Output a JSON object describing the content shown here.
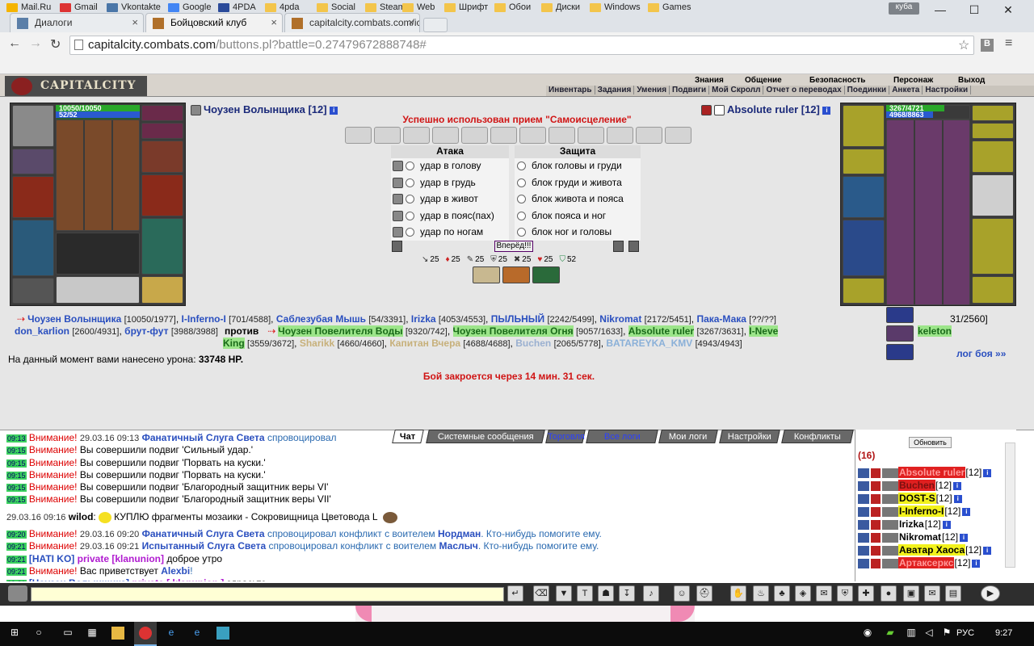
{
  "browser": {
    "tabs": [
      {
        "label": "Диалоги"
      },
      {
        "label": "Бойцовский клуб"
      },
      {
        "label": "capitalcity.combats.com/ic"
      }
    ],
    "profile": "куба",
    "url_host": "capitalcity.combats.com",
    "url_path": "/buttons.pl?battle=0.27479672888748#",
    "bookmarks": [
      "Mail.Ru",
      "Gmail",
      "Vkontakte",
      "Google",
      "4PDA",
      "4pda",
      "Social",
      "Steam",
      "Web",
      "Шрифт",
      "Обои",
      "Диски",
      "Windows",
      "Games"
    ]
  },
  "game": {
    "logo": "CAPITALCITY",
    "top_menu": [
      "Знания",
      "Общение",
      "Безопасность",
      "Персонаж",
      "Выход"
    ],
    "sub_menu": [
      "Инвентарь",
      "Задания",
      "Умения",
      "Подвиги",
      "Мой Скролл",
      "Отчет о переводах",
      "Поединки",
      "Анкета",
      "Настройки"
    ]
  },
  "left_player": {
    "name": "Чоузен Волынщика [12]",
    "hp": "10050/10050",
    "mana": "52/52"
  },
  "right_player": {
    "name": "Absolute ruler [12]",
    "hp": "3267/4721",
    "mana": "4968/8863"
  },
  "battle": {
    "message": "Успешно использован прием \"Самоисцеление\"",
    "attack_title": "Атака",
    "defense_title": "Защита",
    "attacks": [
      "удар в голову",
      "удар в грудь",
      "удар в живот",
      "удар в пояс(пах)",
      "удар по ногам"
    ],
    "defenses": [
      "блок головы и груди",
      "блок груди и живота",
      "блок живота и пояса",
      "блок пояса и ног",
      "блок ног и головы"
    ],
    "forward_button": "Вперёд!!!",
    "stats": [
      "25",
      "25",
      "25",
      "25",
      "25",
      "25",
      "52"
    ],
    "team1": [
      {
        "name": "Чоузен Волынщика",
        "hp": "[10050/1977]"
      },
      {
        "name": "I-Inferno-I",
        "hp": "[701/4588]"
      },
      {
        "name": "Саблезубая Мышь",
        "hp": "[54/3391]"
      },
      {
        "name": "Irizka",
        "hp": "[4053/4553]"
      },
      {
        "name": "ПЫЛЬНЫЙ",
        "hp": "[2242/5499]"
      },
      {
        "name": "Nikromat",
        "hp": "[2172/5451]"
      },
      {
        "name": "Пака-Мака",
        "hp": "[??/??]"
      },
      {
        "name": "don_karlion",
        "hp": "[2600/4931]"
      },
      {
        "name": "брут-фут",
        "hp": "[3988/3988]"
      }
    ],
    "hidden_hp_fragment": "31/2560]",
    "vs": "против",
    "team2": [
      {
        "name": "Чоузен Повелителя Воды",
        "hp": "[9320/742]"
      },
      {
        "name": "Чоузен Повелителя Огня",
        "hp": "[9057/1633]"
      },
      {
        "name": "Absolute ruler",
        "hp": "[3267/3631]"
      },
      {
        "name": "I-Neve",
        "hp": ""
      },
      {
        "name": "keleton",
        "hp": ""
      },
      {
        "name": "King",
        "hp": "[3559/3672]"
      },
      {
        "name": "Sharikk",
        "hp": "[4660/4660]"
      },
      {
        "name": "Капитан Вчера",
        "hp": "[4688/4688]"
      },
      {
        "name": "Buchen",
        "hp": "[2065/5778]"
      },
      {
        "name": "BATAREYKA_KMV",
        "hp": "[4943/4943]"
      }
    ],
    "damage_label": "На данный момент вами нанесено урона:",
    "damage_value": "33748 HP.",
    "close_notice": "Бой закроется через 14 мин. 31 сек.",
    "log_link": "лог боя »»"
  },
  "chat": {
    "tabs": [
      "Чат",
      "Системные сообщения",
      "Торговля",
      "Все логи",
      "Мои логи",
      "Настройки",
      "Конфликты"
    ],
    "lines": [
      {
        "time": "09:13",
        "warn": "Внимание!",
        "date": "29.03.16 09:13",
        "nick": "Фанатичный Слуга Света",
        "text": "спровоцировал"
      },
      {
        "time": "09:15",
        "warn": "Внимание!",
        "text": "Вы совершили подвиг 'Сильный удар.'"
      },
      {
        "time": "09:15",
        "warn": "Внимание!",
        "text": "Вы совершили подвиг 'Порвать на куски.'"
      },
      {
        "time": "09:15",
        "warn": "Внимание!",
        "text": "Вы совершили подвиг 'Порвать на куски.'"
      },
      {
        "time": "09:15",
        "warn": "Внимание!",
        "text": "Вы совершили подвиг 'Благородный защитник веры VI'"
      },
      {
        "time": "09:15",
        "warn": "Внимание!",
        "text": "Вы совершили подвиг 'Благородный защитник веры VII'"
      },
      {
        "date": "29.03.16 09:16",
        "nick": "wilod",
        "text": "КУПЛЮ фрагменты мозаики - Сокровищница Цветовода L"
      },
      {
        "time": "09:20",
        "warn": "Внимание!",
        "date": "29.03.16 09:20",
        "nick": "Фанатичный Слуга Света",
        "text": "спровоцировал конфликт с воителем",
        "target": "Нордман",
        "tail": ". Кто-нибудь помогите ему."
      },
      {
        "time": "09:21",
        "warn": "Внимание!",
        "date": "29.03.16 09:21",
        "nick": "Испытанный Слуга Света",
        "text": "спровоцировал конфликт с воителем",
        "target": "Маслыч",
        "tail": ". Кто-нибудь помогите ему."
      },
      {
        "time": "09:21",
        "nick": "[HATI KO]",
        "priv": "private [klanunion]",
        "text": "доброе утро"
      },
      {
        "time": "09:21",
        "warn": "Внимание!",
        "text": "Вас приветствует",
        "target": "Alexbi",
        "tail": "!"
      },
      {
        "time": "09:21",
        "nick": "[Чоузен Волынщика]",
        "priv": "private [ klanunion ]",
        "text": "здрасьте"
      }
    ],
    "refresh_button": "Обновить",
    "online_count": "(16)",
    "users": [
      {
        "name": "Absolute ruler",
        "level": "[12]",
        "bg": "#e02020",
        "fg": "#ff9a9a"
      },
      {
        "name": "Buchen",
        "level": "[12]",
        "bg": "#e02020",
        "fg": "#7a1010"
      },
      {
        "name": "DOST-S",
        "level": "[12]",
        "bg": "#f2f21c",
        "fg": "#000"
      },
      {
        "name": "I-Inferno-I",
        "level": "[12]",
        "bg": "#f2f21c",
        "fg": "#000"
      },
      {
        "name": "Irizka",
        "level": "[12]",
        "bg": "#ffffff",
        "fg": "#000"
      },
      {
        "name": "Nikromat",
        "level": "[12]",
        "bg": "#ffffff",
        "fg": "#000"
      },
      {
        "name": "Аватар Хаоса",
        "level": "[12]",
        "bg": "#f2f21c",
        "fg": "#000"
      },
      {
        "name": "Артаксеркс",
        "level": "[12]",
        "bg": "#e02020",
        "fg": "#ff9a9a"
      }
    ]
  },
  "taskbar": {
    "lang": "РУС",
    "time": "9:27"
  }
}
